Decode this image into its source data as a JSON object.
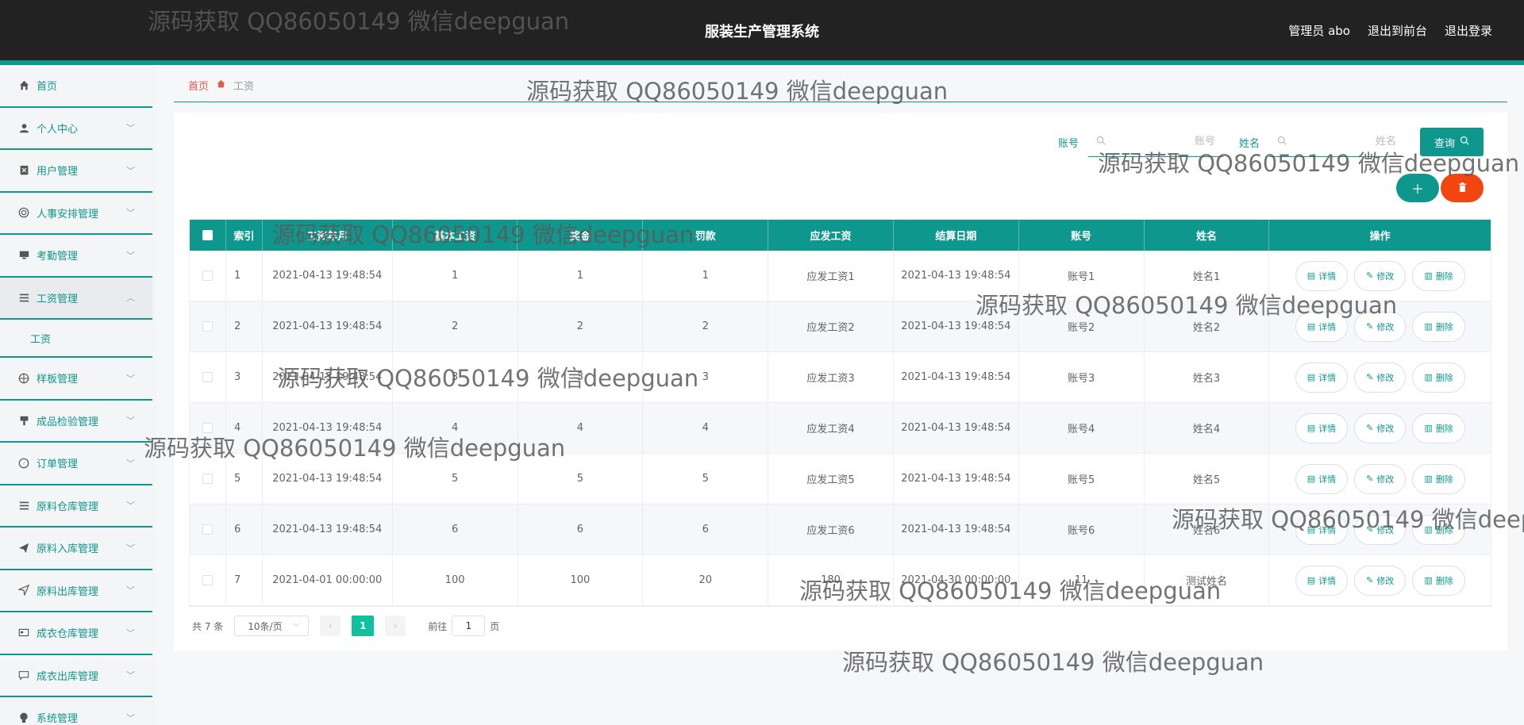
{
  "header": {
    "title": "服装生产管理系统",
    "user": "管理员 abo",
    "to_front": "退出到前台",
    "logout": "退出登录"
  },
  "sidebar": {
    "items": [
      {
        "label": "首页",
        "icon": "home-icon",
        "chevron": false
      },
      {
        "label": "个人中心",
        "icon": "user-icon",
        "chevron": true
      },
      {
        "label": "用户管理",
        "icon": "user-box-icon",
        "chevron": true
      },
      {
        "label": "人事安排管理",
        "icon": "target-icon",
        "chevron": true
      },
      {
        "label": "考勤管理",
        "icon": "monitor-icon",
        "chevron": true
      },
      {
        "label": "工资管理",
        "icon": "list-icon",
        "chevron": true,
        "active": true,
        "sub": [
          "工资"
        ]
      },
      {
        "label": "样板管理",
        "icon": "crosshair-icon",
        "chevron": true
      },
      {
        "label": "成品检验管理",
        "icon": "brush-icon",
        "chevron": true
      },
      {
        "label": "订单管理",
        "icon": "compass-icon",
        "chevron": true
      },
      {
        "label": "原料仓库管理",
        "icon": "list-icon",
        "chevron": true
      },
      {
        "label": "原料入库管理",
        "icon": "send-icon",
        "chevron": true
      },
      {
        "label": "原料出库管理",
        "icon": "navigate-icon",
        "chevron": true
      },
      {
        "label": "成衣仓库管理",
        "icon": "card-icon",
        "chevron": true
      },
      {
        "label": "成衣出库管理",
        "icon": "chat-icon",
        "chevron": true
      },
      {
        "label": "系统管理",
        "icon": "bulb-icon",
        "chevron": true
      }
    ]
  },
  "breadcrumb": {
    "home": "首页",
    "current": "工资"
  },
  "search": {
    "field1_label": "账号",
    "field1_placeholder": "账号",
    "field2_label": "姓名",
    "field2_placeholder": "姓名",
    "query_label": "查询"
  },
  "table": {
    "headers": [
      "索引",
      "工资年月",
      "基本工资",
      "奖金",
      "罚款",
      "应发工资",
      "结算日期",
      "账号",
      "姓名",
      "操作"
    ],
    "rows": [
      [
        "1",
        "2021-04-13 19:48:54",
        "1",
        "1",
        "1",
        "应发工资1",
        "2021-04-13 19:48:54",
        "账号1",
        "姓名1"
      ],
      [
        "2",
        "2021-04-13 19:48:54",
        "2",
        "2",
        "2",
        "应发工资2",
        "2021-04-13 19:48:54",
        "账号2",
        "姓名2"
      ],
      [
        "3",
        "2021-04-13 19:48:54",
        "3",
        "3",
        "3",
        "应发工资3",
        "2021-04-13 19:48:54",
        "账号3",
        "姓名3"
      ],
      [
        "4",
        "2021-04-13 19:48:54",
        "4",
        "4",
        "4",
        "应发工资4",
        "2021-04-13 19:48:54",
        "账号4",
        "姓名4"
      ],
      [
        "5",
        "2021-04-13 19:48:54",
        "5",
        "5",
        "5",
        "应发工资5",
        "2021-04-13 19:48:54",
        "账号5",
        "姓名5"
      ],
      [
        "6",
        "2021-04-13 19:48:54",
        "6",
        "6",
        "6",
        "应发工资6",
        "2021-04-13 19:48:54",
        "账号6",
        "姓名6"
      ],
      [
        "7",
        "2021-04-01 00:00:00",
        "100",
        "100",
        "20",
        "180",
        "2021-04-30 00:00:00",
        "11",
        "测试姓名"
      ]
    ],
    "ops": [
      "详情",
      "修改",
      "删除"
    ]
  },
  "pager": {
    "total": "共 7 条",
    "page_size": "10条/页",
    "current_page": "1",
    "goto_label": "前往",
    "goto_value": "1",
    "page_suffix": "页"
  },
  "watermark": "源码获取 QQ86050149 微信deepguan",
  "colors": {
    "accent": "#0e978c",
    "danger": "#f2450f",
    "header": "#222222"
  }
}
